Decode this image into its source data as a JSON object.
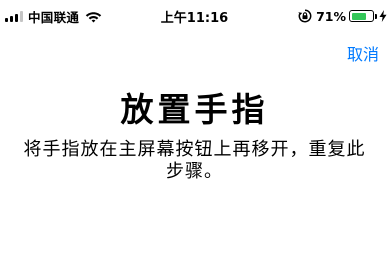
{
  "status_bar": {
    "carrier": "中国联通",
    "time": "上午11:16",
    "battery_percent": "71%",
    "battery_level": 0.71,
    "battery_color": "#34c759",
    "icons": [
      "signal-icon",
      "wifi-icon",
      "rotation-lock-icon",
      "battery-icon",
      "charging-bolt-icon"
    ]
  },
  "nav": {
    "cancel_label": "取消",
    "accent_color": "#007aff"
  },
  "content": {
    "title": "放置手指",
    "instruction": "将手指放在主屏幕按钮上再移开，重复此步骤。"
  }
}
